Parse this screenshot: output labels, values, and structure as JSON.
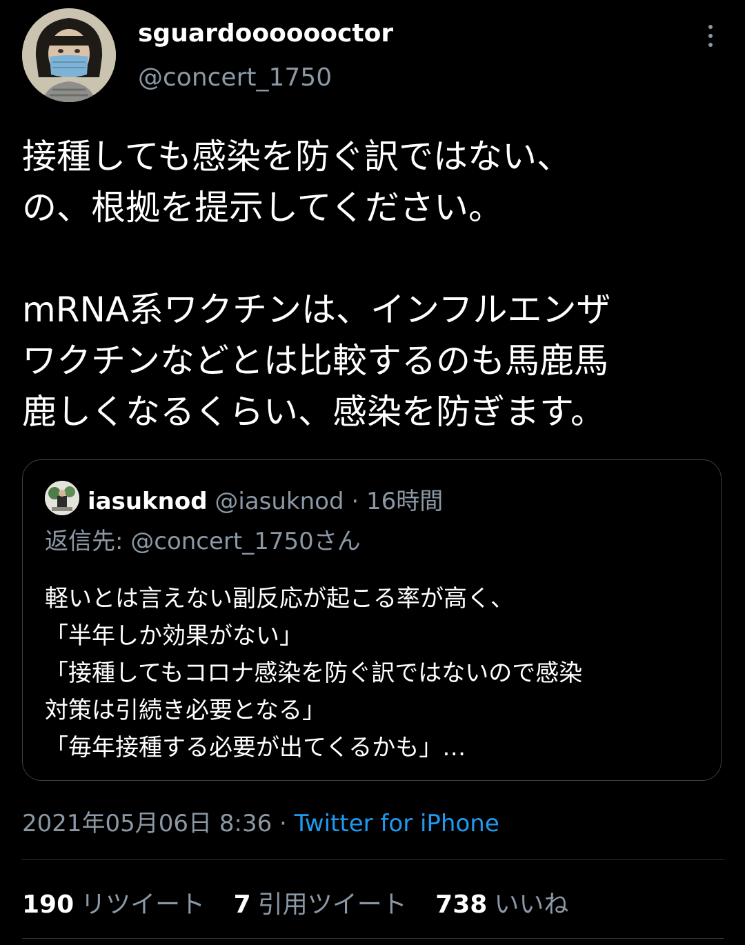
{
  "author": {
    "name": "sguardooooooctor",
    "handle": "@concert_1750"
  },
  "tweet": {
    "lines": [
      "接種しても感染を防ぐ訳ではない、",
      "の、根拠を提示してください。"
    ],
    "lines2": [
      "mRNA系ワクチンは、インフルエンザ",
      "ワクチンなどとは比較するのも馬鹿馬",
      "鹿しくなるくらい、感染を防ぎます。"
    ]
  },
  "quote": {
    "name": "iasuknod",
    "handle": "@iasuknod",
    "separator": "·",
    "time": "16時間",
    "reply_to": "返信先: @concert_1750さん",
    "lines": [
      "軽いとは言えない副反応が起こる率が高く、",
      "「半年しか効果がない」",
      "「接種してもコロナ感染を防ぐ訳ではないので感染",
      "対策は引続き必要となる」",
      "「毎年接種する必要が出てくるかも」…"
    ]
  },
  "meta": {
    "datetime": "2021年05月06日 8:36",
    "separator": "·",
    "source": "Twitter for iPhone"
  },
  "stats": {
    "retweets_count": "190",
    "retweets_label": "リツイート",
    "quotes_count": "7",
    "quotes_label": "引用ツイート",
    "likes_count": "738",
    "likes_label": "いいね"
  },
  "icons": {
    "more": "more-vertical-icon"
  }
}
